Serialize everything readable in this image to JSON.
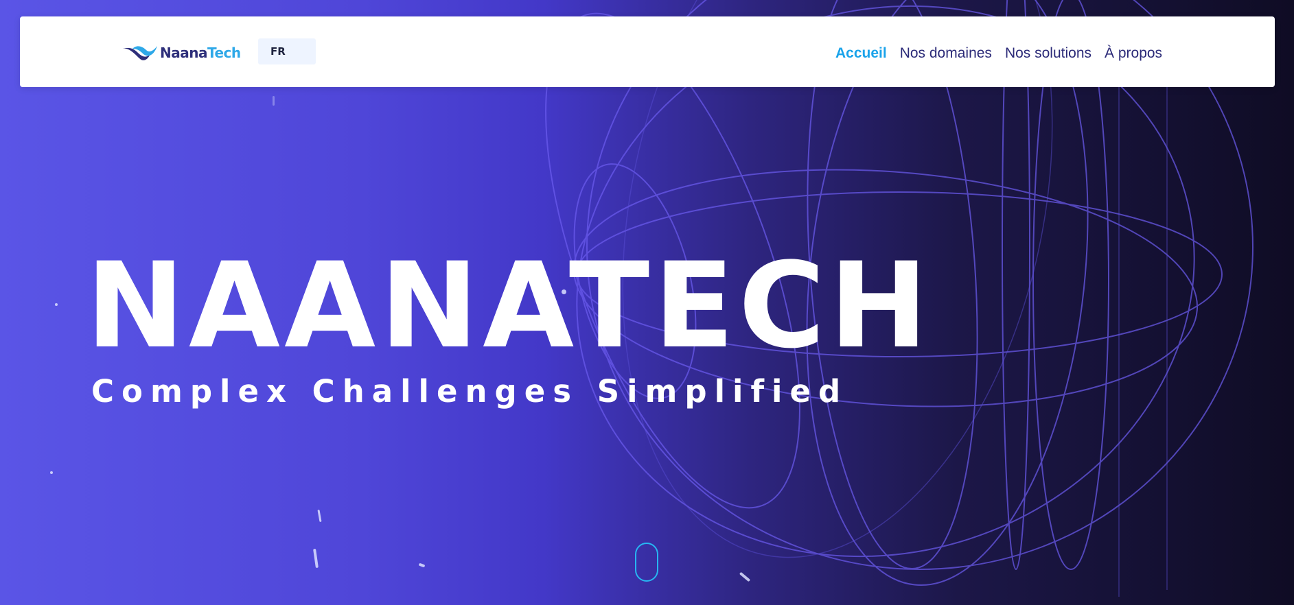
{
  "brand": {
    "logo_part1": "Naana",
    "logo_part2": "Tech",
    "colors": {
      "accent": "#1aa3ea",
      "nav_text": "#2b2a78",
      "logo_dark": "#2e2f7a",
      "logo_light": "#2ea8e8"
    }
  },
  "header": {
    "language": "FR",
    "nav": [
      {
        "label": "Accueil",
        "active": true
      },
      {
        "label": "Nos domaines",
        "active": false
      },
      {
        "label": "Nos solutions",
        "active": false
      },
      {
        "label": "À propos",
        "active": false
      }
    ]
  },
  "hero": {
    "title": "NAANATECH",
    "subtitle": "Complex Challenges Simplified",
    "scroll_icon": "mouse-scroll-icon"
  }
}
